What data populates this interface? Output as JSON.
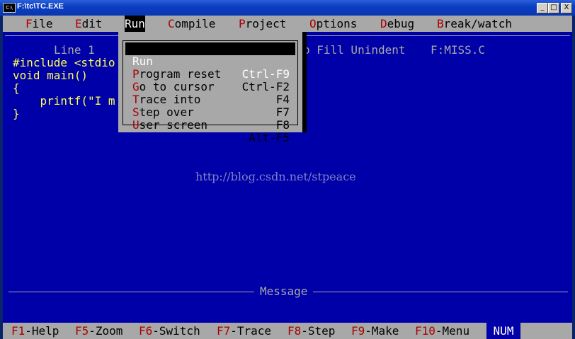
{
  "window": {
    "icon_text": "C:\\",
    "title": "F:\\tc\\TC.EXE",
    "minimize": "_",
    "maximize": "□",
    "close": "X"
  },
  "menubar": {
    "items": [
      {
        "hotkey": "F",
        "rest": "ile"
      },
      {
        "hotkey": "E",
        "rest": "dit"
      },
      {
        "hotkey": "R",
        "rest": "un"
      },
      {
        "hotkey": "C",
        "rest": "ompile"
      },
      {
        "hotkey": "P",
        "rest": "roject"
      },
      {
        "hotkey": "O",
        "rest": "ptions"
      },
      {
        "hotkey": "D",
        "rest": "ebug"
      },
      {
        "hotkey": "B",
        "rest": "reak/watch"
      }
    ]
  },
  "editor": {
    "line": "Line 1",
    "status_tail": "b Fill Unindent",
    "filename": "F:MISS.C",
    "code_lines": [
      "#include <stdio",
      "void main()",
      "{",
      "    printf(\"I m",
      "}"
    ]
  },
  "run_menu": {
    "items": [
      {
        "hotkey": "R",
        "rest": "un",
        "shortcut": "Ctrl-F9"
      },
      {
        "hotkey": "P",
        "rest": "rogram reset",
        "shortcut": "Ctrl-F2"
      },
      {
        "hotkey": "G",
        "rest": "o to cursor",
        "shortcut": "F4"
      },
      {
        "hotkey": "T",
        "rest": "race into",
        "shortcut": "F7"
      },
      {
        "hotkey": "S",
        "rest": "tep over",
        "shortcut": "F8"
      },
      {
        "hotkey": "U",
        "rest": "ser screen",
        "shortcut": "Alt-F5"
      }
    ]
  },
  "watermark": "http://blog.csdn.net/stpeace",
  "message_label": "Message",
  "bottombar": {
    "keys": [
      {
        "key": "F1",
        "label": "-Help"
      },
      {
        "key": "F5",
        "label": "-Zoom"
      },
      {
        "key": "F6",
        "label": "-Switch"
      },
      {
        "key": "F7",
        "label": "-Trace"
      },
      {
        "key": "F8",
        "label": "-Step"
      },
      {
        "key": "F9",
        "label": "-Make"
      },
      {
        "key": "F10",
        "label": "-Menu"
      }
    ],
    "num": "NUM"
  }
}
